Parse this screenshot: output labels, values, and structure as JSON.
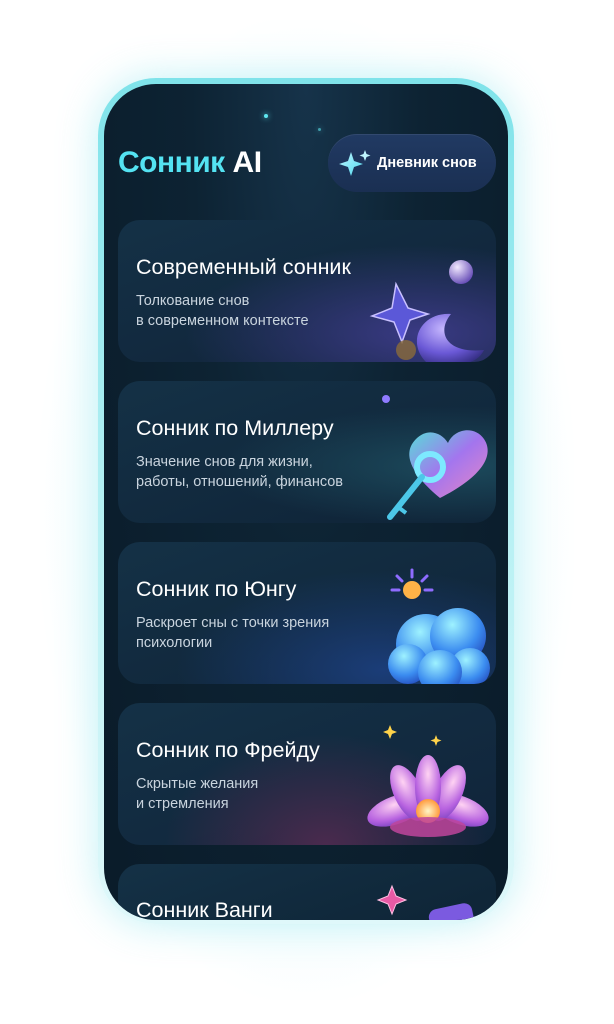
{
  "header": {
    "title_part1": "Сонник",
    "title_part2": "AI",
    "diary_button_label": "Дневник снов"
  },
  "cards": [
    {
      "title": "Современный сонник",
      "desc_line1": "Толкование снов",
      "desc_line2": "в современном контексте",
      "icon": "moon-star-icon"
    },
    {
      "title": "Сонник по Миллеру",
      "desc_line1": "Значение снов для жизни,",
      "desc_line2": "работы, отношений, финансов",
      "icon": "heart-key-icon"
    },
    {
      "title": "Сонник по Юнгу",
      "desc_line1": "Раскроет сны с точки зрения",
      "desc_line2": "психологии",
      "icon": "cloud-sun-icon"
    },
    {
      "title": "Сонник по Фрейду",
      "desc_line1": "Скрытые желания",
      "desc_line2": "и стремления",
      "icon": "flower-icon"
    },
    {
      "title": "Сонник Ванги",
      "desc_line1": "",
      "desc_line2": "",
      "icon": "star-icon"
    }
  ],
  "colors": {
    "accent_cyan": "#54e3f2",
    "background": "#0a1b29",
    "card": "#143146",
    "button": "#213a63"
  }
}
